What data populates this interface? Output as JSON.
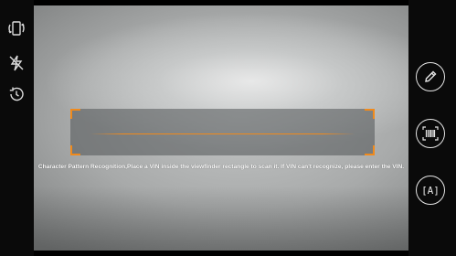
{
  "left_toolbar": {
    "icons": [
      "rotate-screen-icon",
      "flash-off-icon",
      "history-icon"
    ]
  },
  "viewfinder": {
    "accent_color": "#f08a1c",
    "hint": "Character Pattern Recognition,Place a VIN inside the viewfinder rectangle to scan it. If VIN can't recognize, please enter the VIN."
  },
  "right_toolbar": {
    "buttons": [
      {
        "icon": "edit-pencil-icon",
        "label": ""
      },
      {
        "icon": "barcode-scan-icon",
        "label": ""
      },
      {
        "icon": "text-recognition-icon",
        "label": "[A]"
      }
    ]
  }
}
